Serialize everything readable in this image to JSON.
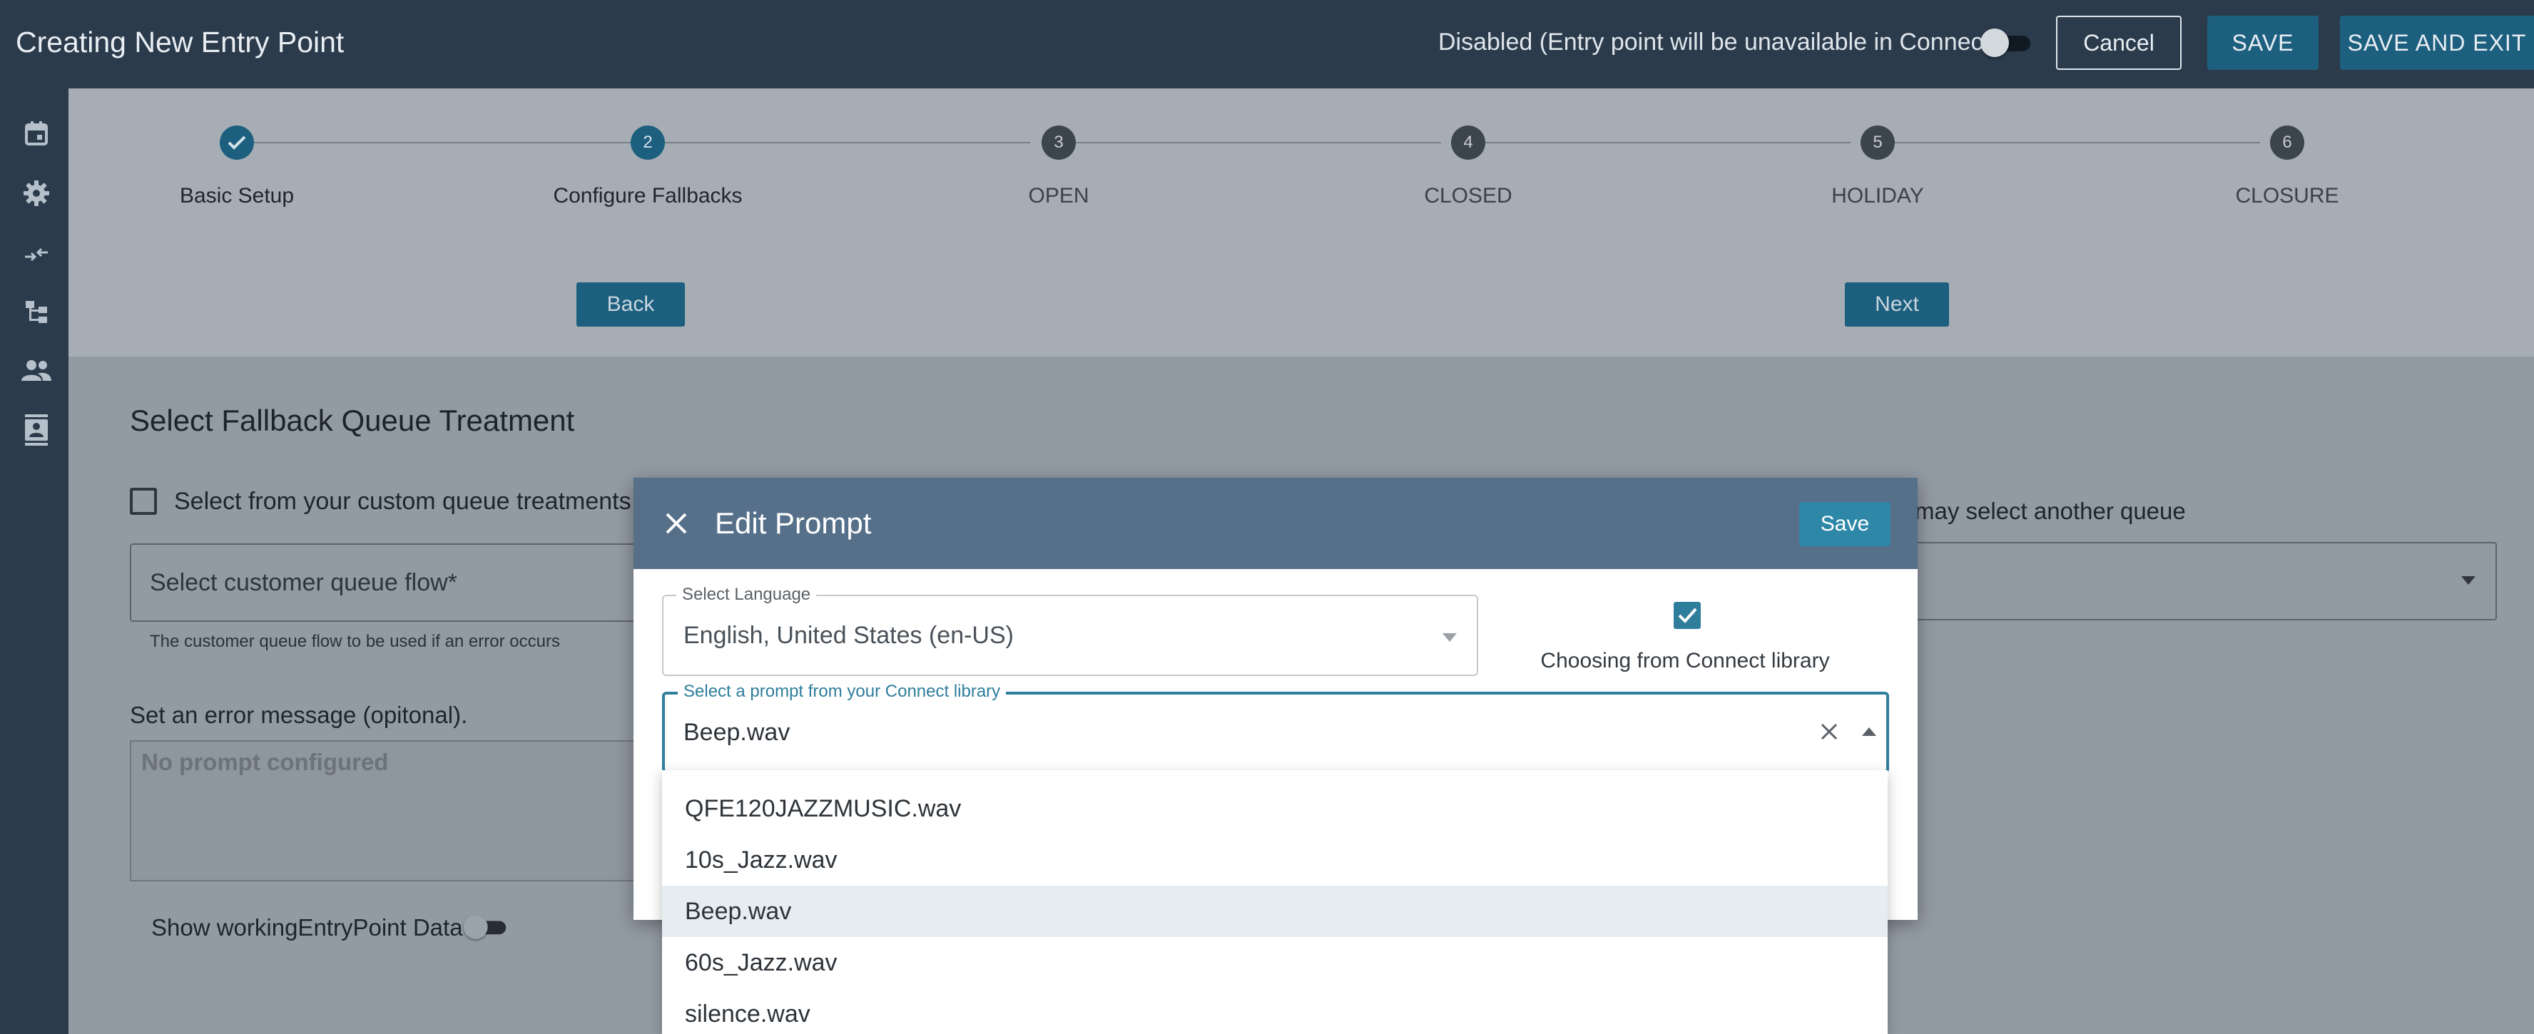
{
  "header": {
    "title": "Creating New Entry Point",
    "status_text": "Disabled (Entry point will be unavailable in Connect)",
    "cancel_label": "Cancel",
    "save_label": "SAVE",
    "save_exit_label": "SAVE AND EXIT"
  },
  "sidebar": {
    "items": [
      {
        "icon": "calendar-icon"
      },
      {
        "icon": "gear-icon"
      },
      {
        "icon": "merge-arrows-icon"
      },
      {
        "icon": "flow-tree-icon"
      },
      {
        "icon": "people-icon"
      },
      {
        "icon": "contact-card-icon"
      }
    ]
  },
  "stepper": {
    "steps": [
      {
        "number": "",
        "label": "Basic Setup",
        "state": "complete"
      },
      {
        "number": "2",
        "label": "Configure Fallbacks",
        "state": "active"
      },
      {
        "number": "3",
        "label": "OPEN",
        "state": "pending"
      },
      {
        "number": "4",
        "label": "CLOSED",
        "state": "pending"
      },
      {
        "number": "5",
        "label": "HOLIDAY",
        "state": "pending"
      },
      {
        "number": "6",
        "label": "CLOSURE",
        "state": "pending"
      }
    ],
    "back_label": "Back",
    "next_label": "Next"
  },
  "fallback": {
    "section_title": "Select Fallback Queue Treatment",
    "custom_checkbox_label": "Select from your custom queue treatments",
    "queue_flow_placeholder": "Select customer queue flow*",
    "queue_flow_helper": "The customer queue flow to be used if an error occurs",
    "another_queue_label": "may select another queue",
    "error_message_label": "Set an error message (opitonal).",
    "error_message_placeholder": "No prompt configured",
    "show_data_label": "Show workingEntryPoint Data"
  },
  "modal": {
    "title": "Edit Prompt",
    "save_label": "Save",
    "language_legend": "Select Language",
    "language_value": "English, United States (en-US)",
    "library_checkbox_label": "Choosing from Connect library",
    "library_checked": true,
    "prompt_legend": "Select a prompt from your Connect library",
    "prompt_value": "Beep.wav",
    "options": [
      "QFE120JAZZMUSIC.wav",
      "10s_Jazz.wav",
      "Beep.wav",
      "60s_Jazz.wav",
      "silence.wav"
    ],
    "selected_option": "Beep.wav"
  },
  "colors": {
    "topbar": "#2b3b4c",
    "accent": "#1d5f7e",
    "modal_header": "#56708a",
    "focus": "#2f7e9b"
  }
}
